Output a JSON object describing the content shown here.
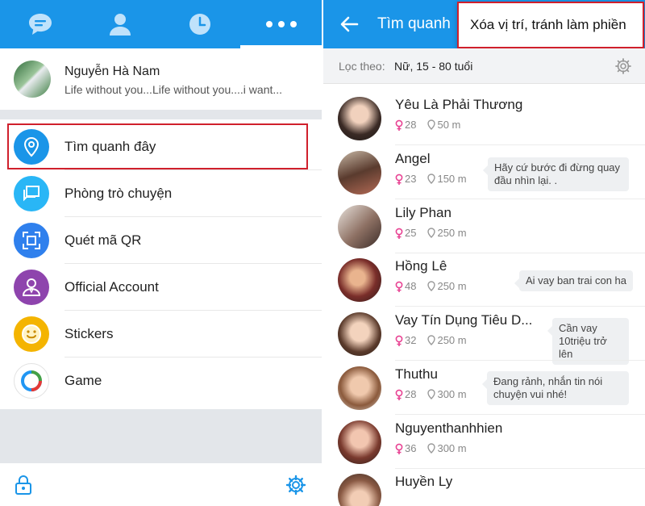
{
  "left": {
    "tabs": [
      {
        "icon": "chat-icon"
      },
      {
        "icon": "contacts-icon"
      },
      {
        "icon": "clock-icon"
      },
      {
        "icon": "more-icon"
      }
    ],
    "profile": {
      "name": "Nguyễn Hà Nam",
      "status": "Life without you...Life without you....i want..."
    },
    "menu": [
      {
        "label": "Tìm quanh đây",
        "icon": "location-pin-icon",
        "color": "#1a95e8"
      },
      {
        "label": "Phòng trò chuyện",
        "icon": "chat-rooms-icon",
        "color": "#29b6f6"
      },
      {
        "label": "Quét mã QR",
        "icon": "qr-scan-icon",
        "color": "#2f80ed"
      },
      {
        "label": "Official Account",
        "icon": "official-account-icon",
        "color": "#8e44ad"
      },
      {
        "label": "Stickers",
        "icon": "smiley-icon",
        "color": "#f4b400"
      },
      {
        "label": "Game",
        "icon": "game-logo-icon",
        "color": "#ffffff"
      }
    ],
    "bottom": {
      "lock_icon": "lock-icon",
      "settings_icon": "gear-icon"
    }
  },
  "right": {
    "title": "Tìm quanh",
    "popup": "Xóa vị trí, tránh làm phiền",
    "filter": {
      "label": "Lọc theo:",
      "value": "Nữ, 15 - 80 tuổi"
    },
    "people": [
      {
        "name": "Yêu Là Phải Thương",
        "age": "28",
        "distance": "50 m",
        "bubble": ""
      },
      {
        "name": "Angel",
        "age": "23",
        "distance": "150 m",
        "bubble": "Hãy cứ bước đi đừng quay đầu nhìn lại.  ."
      },
      {
        "name": "Lily Phan",
        "age": "25",
        "distance": "250 m",
        "bubble": ""
      },
      {
        "name": "Hồng Lê",
        "age": "48",
        "distance": "250 m",
        "bubble": "Ai vay ban trai con ha"
      },
      {
        "name": "Vay Tín Dụng Tiêu D...",
        "age": "32",
        "distance": "250 m",
        "bubble": "Cần vay 10triệu trở lên"
      },
      {
        "name": "Thuthu",
        "age": "28",
        "distance": "300 m",
        "bubble": "Đang rảnh, nhắn tin nói chuyện vui nhé!"
      },
      {
        "name": "Nguyenthanhhien",
        "age": "36",
        "distance": "300 m",
        "bubble": ""
      },
      {
        "name": "Huyền Ly",
        "age": "",
        "distance": "",
        "bubble": ""
      }
    ]
  },
  "colors": {
    "brand_blue": "#1a95e8",
    "highlight_red": "#d0202c",
    "gender_pink": "#e84393"
  }
}
